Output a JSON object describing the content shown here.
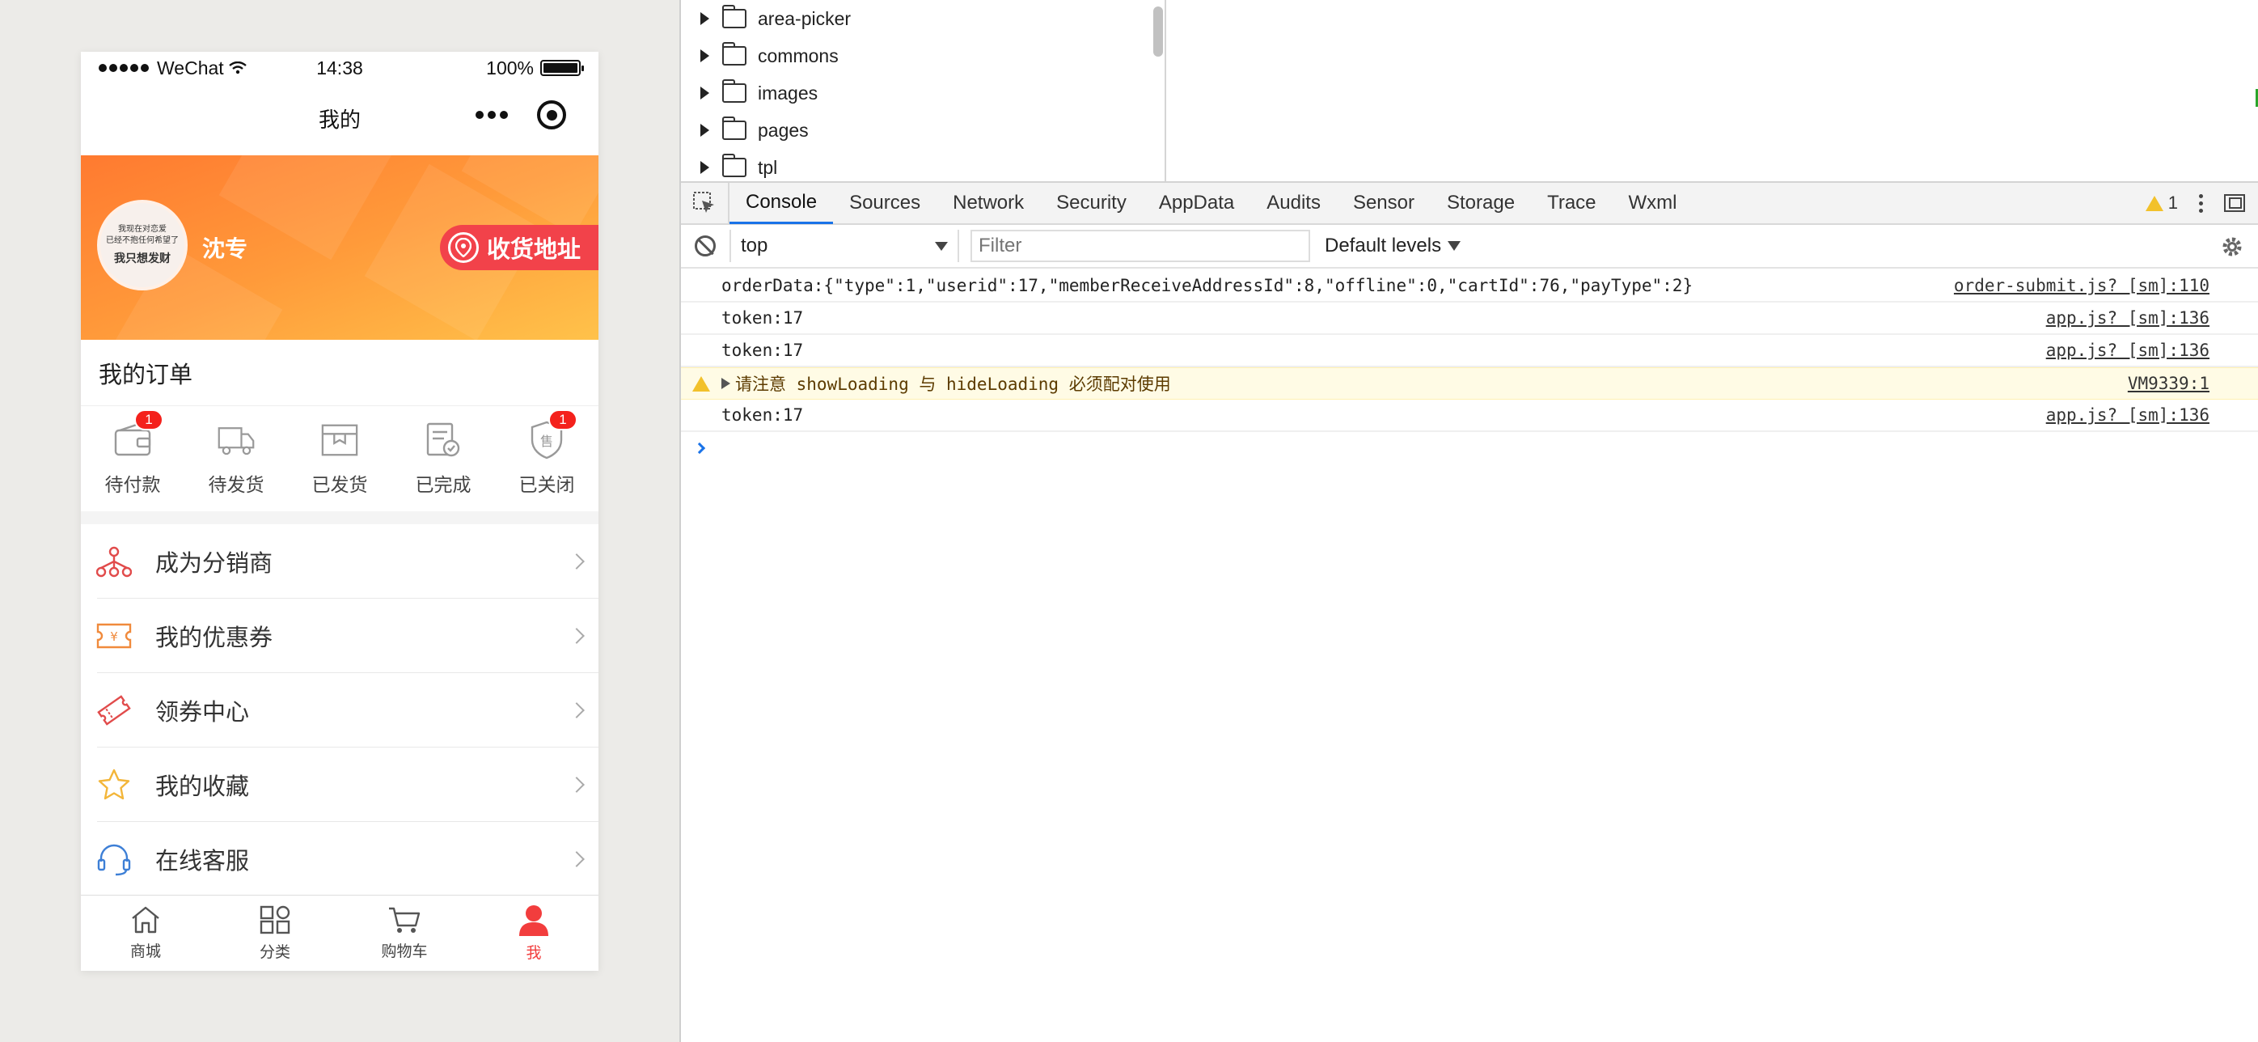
{
  "phone": {
    "status": {
      "carrier": "WeChat",
      "time": "14:38",
      "battery": "100%",
      "battery_level": 1.0
    },
    "nav_title": "我的",
    "profile": {
      "avatar_lines": [
        "我现在对恋爱",
        "已经不抱任何希望了",
        "我只想发财"
      ],
      "username": "沈专",
      "address_button": "收货地址"
    },
    "orders": {
      "title": "我的订单",
      "items": [
        {
          "label": "待付款",
          "badge": "1",
          "icon": "wallet-icon"
        },
        {
          "label": "待发货",
          "badge": "",
          "icon": "truck-icon"
        },
        {
          "label": "已发货",
          "badge": "",
          "icon": "package-icon"
        },
        {
          "label": "已完成",
          "badge": "",
          "icon": "completed-icon"
        },
        {
          "label": "已关闭",
          "badge": "1",
          "icon": "aftersale-icon"
        }
      ]
    },
    "menu": [
      {
        "label": "成为分销商",
        "icon": "distribution-icon",
        "color": "#e14b4b"
      },
      {
        "label": "我的优惠券",
        "icon": "coupon-icon",
        "color": "#f08a3c"
      },
      {
        "label": "领券中心",
        "icon": "ticket-icon",
        "color": "#e14b4b"
      },
      {
        "label": "我的收藏",
        "icon": "star-icon",
        "color": "#f3b63a"
      },
      {
        "label": "在线客服",
        "icon": "headset-icon",
        "color": "#3d7fd6"
      }
    ],
    "tabbar": [
      {
        "label": "商城",
        "icon": "home-icon",
        "active": false
      },
      {
        "label": "分类",
        "icon": "category-icon",
        "active": false
      },
      {
        "label": "购物车",
        "icon": "cart-icon",
        "active": false
      },
      {
        "label": "我",
        "icon": "user-icon",
        "active": true
      }
    ],
    "accent": "#f23d3d"
  },
  "devtools": {
    "tree": [
      "area-picker",
      "commons",
      "images",
      "pages",
      "tpl"
    ],
    "tabs": [
      "Console",
      "Sources",
      "Network",
      "Security",
      "AppData",
      "Audits",
      "Sensor",
      "Storage",
      "Trace",
      "Wxml"
    ],
    "active_tab": "Console",
    "warning_count": "1",
    "console": {
      "context": "top",
      "filter_placeholder": "Filter",
      "levels": "Default levels",
      "logs": [
        {
          "type": "log",
          "text": "orderData:{\"type\":1,\"userid\":17,\"memberReceiveAddressId\":8,\"offline\":0,\"cartId\":76,\"payType\":2}",
          "source": "order-submit.js? [sm]:110"
        },
        {
          "type": "log",
          "text": "token:17",
          "source": "app.js? [sm]:136"
        },
        {
          "type": "log",
          "text": "token:17",
          "source": "app.js? [sm]:136"
        },
        {
          "type": "warn",
          "text": "请注意 showLoading 与 hideLoading 必须配对使用",
          "source": "VM9339:1"
        },
        {
          "type": "log",
          "text": "token:17",
          "source": "app.js? [sm]:136"
        }
      ]
    }
  }
}
